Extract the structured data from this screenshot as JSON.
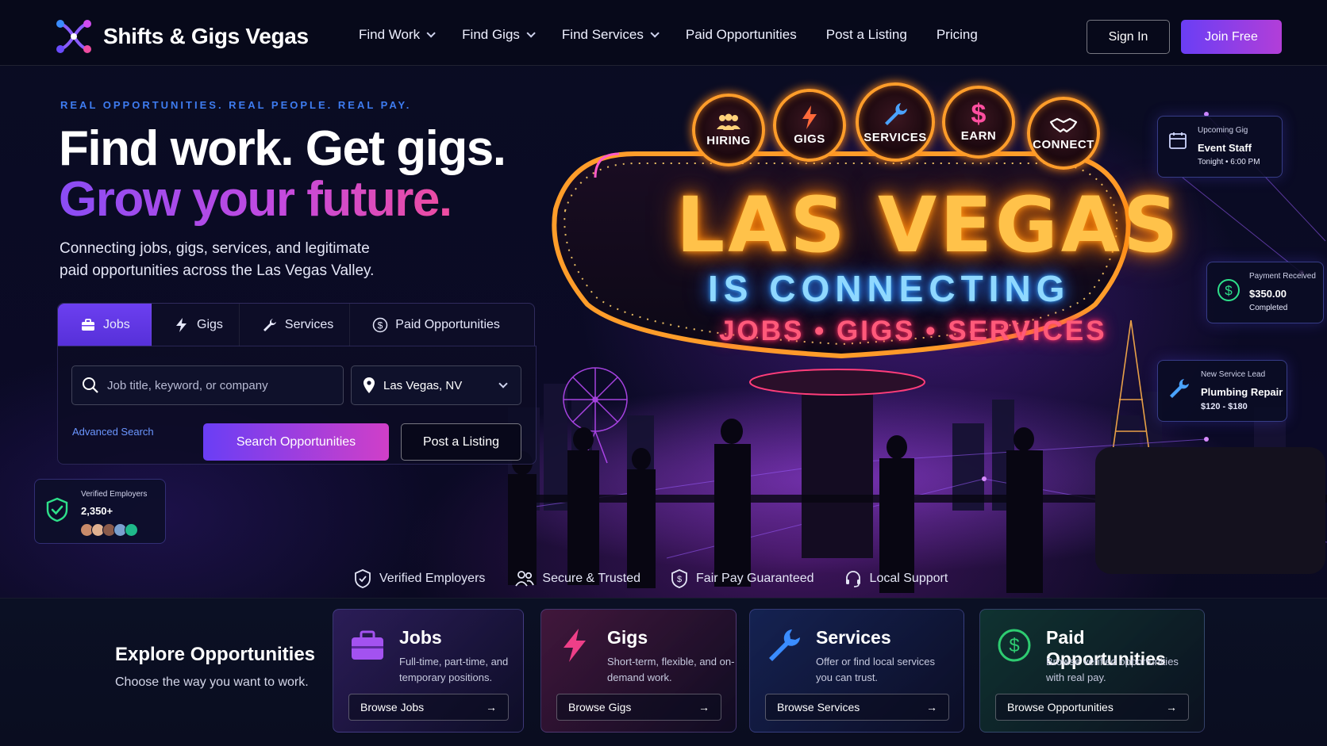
{
  "brand": {
    "name": "Shifts & Gigs Vegas"
  },
  "nav": {
    "links": [
      {
        "label": "Find Work",
        "dropdown": true
      },
      {
        "label": "Find Gigs",
        "dropdown": true
      },
      {
        "label": "Find Services",
        "dropdown": true
      },
      {
        "label": "Paid Opportunities",
        "dropdown": false
      },
      {
        "label": "Post a Listing",
        "dropdown": false
      },
      {
        "label": "Pricing",
        "dropdown": false
      }
    ],
    "sign_in": "Sign In",
    "join": "Join Free"
  },
  "hero": {
    "eyebrow": "REAL OPPORTUNITIES. REAL PEOPLE. REAL PAY.",
    "headline_1": "Find work. Get gigs.",
    "headline_2": "Grow your future.",
    "subtitle": "Connecting jobs, gigs, services, and legitimate paid opportunities across the Las Vegas Valley."
  },
  "search": {
    "tabs": [
      {
        "label": "Jobs",
        "icon": "briefcase-icon",
        "active": true
      },
      {
        "label": "Gigs",
        "icon": "lightning-icon",
        "active": false
      },
      {
        "label": "Services",
        "icon": "wrench-icon",
        "active": false
      },
      {
        "label": "Paid Opportunities",
        "icon": "dollar-icon",
        "active": false
      }
    ],
    "keyword_placeholder": "Job title, keyword, or company",
    "location_value": "Las Vegas, NV",
    "advanced": "Advanced Search",
    "search_button": "Search Opportunities",
    "post_button": "Post a Listing"
  },
  "verified_card": {
    "label": "Verified Employers",
    "count": "2,350+"
  },
  "sign": {
    "medallions": [
      "HIRING",
      "GIGS",
      "SERVICES",
      "EARN",
      "CONNECT"
    ],
    "title": "LAS VEGAS",
    "middle": "IS CONNECTING",
    "bottom": "JOBS • GIGS • SERVICES"
  },
  "float_cards": {
    "gig": {
      "title": "Upcoming Gig",
      "main": "Event Staff",
      "sub": "Tonight • 6:00 PM"
    },
    "payment": {
      "title": "Payment Received",
      "main": "$350.00",
      "sub": "Completed"
    },
    "lead": {
      "title": "New Service Lead",
      "main": "Plumbing Repair",
      "sub": "$120 - $180"
    }
  },
  "trust": [
    {
      "label": "Verified Employers",
      "icon": "shield-check-icon"
    },
    {
      "label": "Secure & Trusted",
      "icon": "users-icon"
    },
    {
      "label": "Fair Pay Guaranteed",
      "icon": "shield-dollar-icon"
    },
    {
      "label": "Local Support",
      "icon": "headset-icon"
    }
  ],
  "explore": {
    "title": "Explore Opportunities",
    "subtitle": "Choose the way you want to work.",
    "cards": [
      {
        "title": "Jobs",
        "desc": "Full-time, part-time, and temporary positions.",
        "button": "Browse Jobs",
        "icon": "briefcase-icon",
        "accent": "#a352f0"
      },
      {
        "title": "Gigs",
        "desc": "Short-term, flexible, and on-demand work.",
        "button": "Browse Gigs",
        "icon": "lightning-icon",
        "accent": "#ee3f88"
      },
      {
        "title": "Services",
        "desc": "Offer or find local services you can trust.",
        "button": "Browse Services",
        "icon": "wrench-icon",
        "accent": "#3a8cff"
      },
      {
        "title": "Paid Opportunities",
        "desc": "Browse verified opportunities with real pay.",
        "button": "Browse Opportunities",
        "icon": "dollar-icon",
        "accent": "#2ecc71"
      }
    ]
  },
  "colors": {
    "accent_purple": "#6a3ef5",
    "accent_pink": "#d03fc8",
    "link_blue": "#6b96ff",
    "eyebrow_blue": "#3e7cf0"
  }
}
